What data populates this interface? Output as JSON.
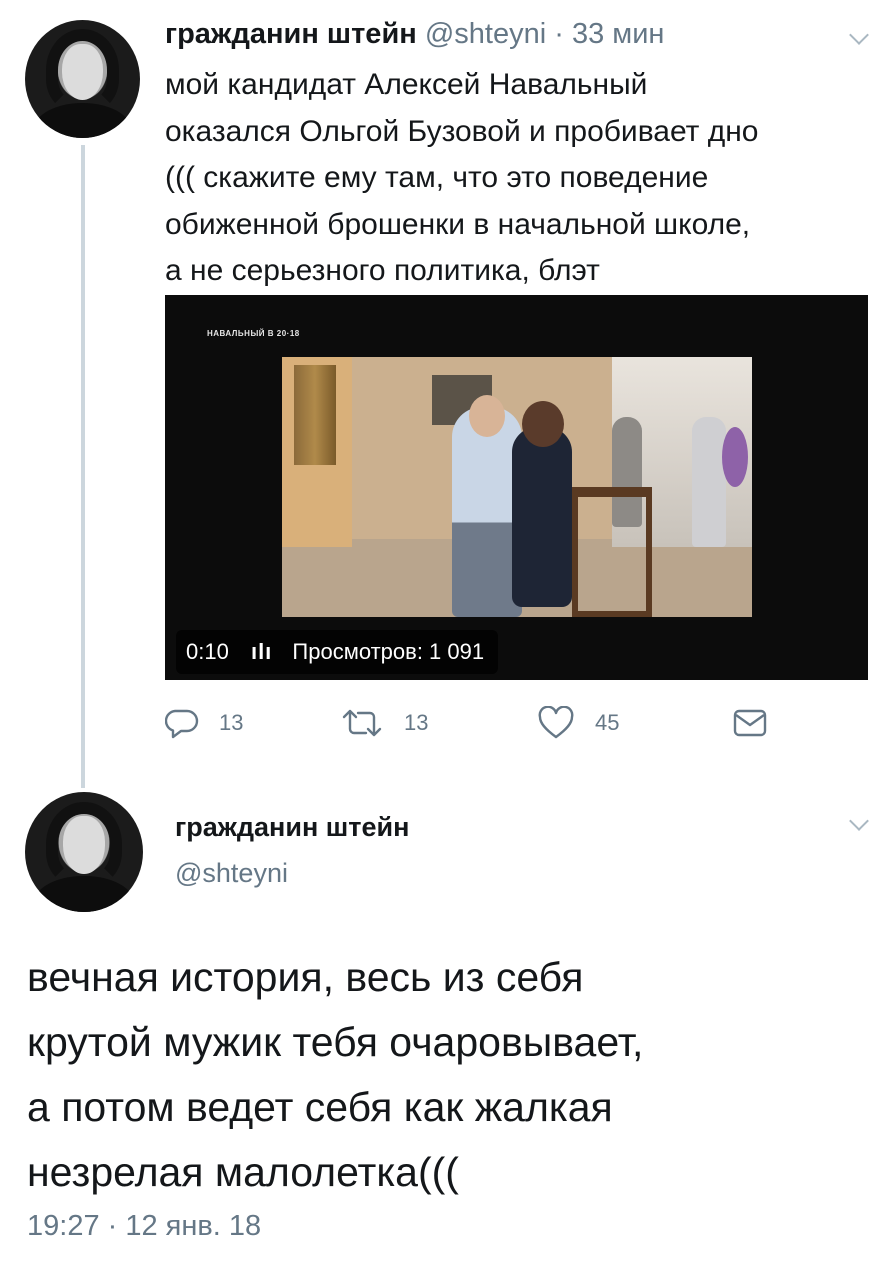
{
  "tweet1": {
    "author_name": "гражданин штейн",
    "handle": "@shteyni",
    "separator": "·",
    "time_ago": "33 мин",
    "text_lines": [
      "мой кандидат Алексей Навальный",
      "оказался Ольгой Бузовой и пробивает дно",
      "((( скажите ему там, что это поведение",
      "обиженной брошенки в начальной школе,",
      "а не серьезного политика, блэт"
    ],
    "media": {
      "brand_text": "НАВАЛЬНЫЙ В 20·18",
      "duration": "0:10",
      "views": "Просмотров: 1 091"
    },
    "actions": {
      "replies": "13",
      "retweets": "13",
      "likes": "45"
    }
  },
  "tweet2": {
    "author_name": "гражданин штейн",
    "handle": "@shteyni",
    "text_lines": [
      "вечная история, весь из себя",
      "крутой мужик тебя очаровывает,",
      "а потом ведет себя как жалкая",
      "незрелая малолетка((("
    ],
    "timestamp": "19:27 · 12 янв. 18"
  },
  "colors": {
    "text_primary": "#14171a",
    "text_secondary": "#657786",
    "thread_line": "#ccd6dd",
    "icon_gray": "#aab8c2"
  }
}
